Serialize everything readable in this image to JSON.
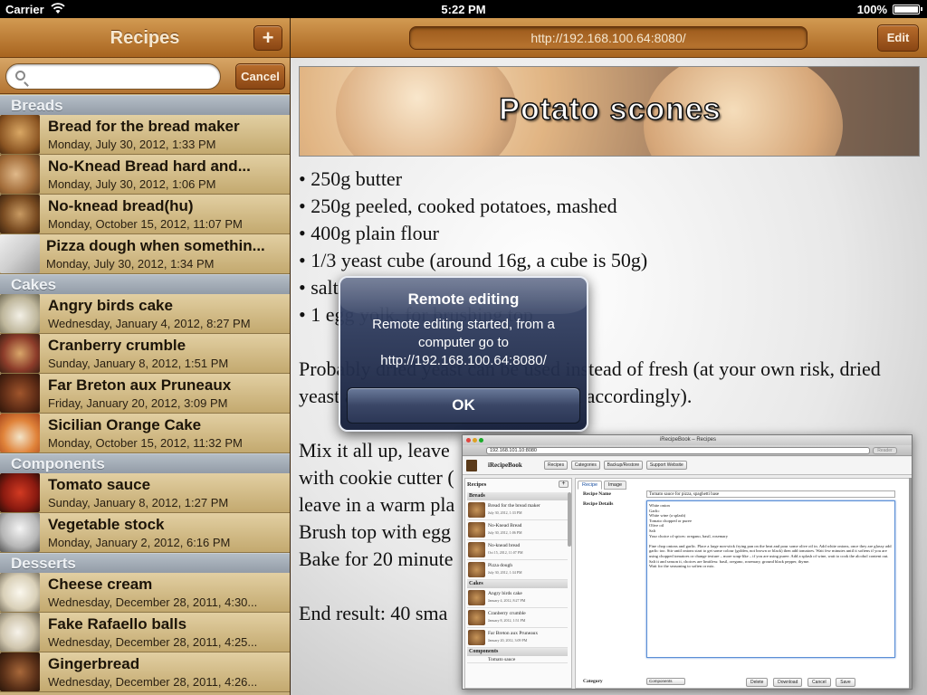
{
  "status_bar": {
    "carrier": "Carrier",
    "time": "5:22 PM",
    "battery": "100%"
  },
  "left_toolbar": {
    "title": "Recipes",
    "add_label": "+"
  },
  "search": {
    "placeholder": "",
    "cancel_label": "Cancel"
  },
  "sections": [
    {
      "name": "Breads",
      "items": [
        {
          "title": "Bread for the bread maker",
          "date": "Monday, July 30, 2012, 1:33 PM"
        },
        {
          "title": "No-Knead Bread hard and...",
          "date": "Monday, July 30, 2012, 1:06 PM"
        },
        {
          "title": "No-knead bread(hu)",
          "date": "Monday, October 15, 2012, 11:07 PM"
        },
        {
          "title": "Pizza dough when somethin...",
          "date": "Monday, July 30, 2012, 1:34 PM"
        }
      ]
    },
    {
      "name": "Cakes",
      "items": [
        {
          "title": "Angry birds cake",
          "date": "Wednesday, January 4, 2012, 8:27 PM"
        },
        {
          "title": "Cranberry crumble",
          "date": "Sunday, January 8, 2012, 1:51 PM"
        },
        {
          "title": "Far Breton aux Pruneaux",
          "date": "Friday, January 20, 2012, 3:09 PM"
        },
        {
          "title": "Sicilian Orange Cake",
          "date": "Monday, October 15, 2012, 11:32 PM"
        }
      ]
    },
    {
      "name": "Components",
      "items": [
        {
          "title": "Tomato sauce",
          "date": "Sunday, January 8, 2012, 1:27 PM"
        },
        {
          "title": "Vegetable stock",
          "date": "Monday, January 2, 2012, 6:16 PM"
        }
      ]
    },
    {
      "name": "Desserts",
      "items": [
        {
          "title": "Cheese cream",
          "date": "Wednesday, December 28, 2011, 4:30..."
        },
        {
          "title": "Fake Rafaello balls",
          "date": "Wednesday, December 28, 2011, 4:25..."
        },
        {
          "title": "Gingerbread",
          "date": "Wednesday, December 28, 2011, 4:26..."
        }
      ]
    }
  ],
  "right_toolbar": {
    "url": "http://192.168.100.64:8080/",
    "edit_label": "Edit"
  },
  "recipe": {
    "title": "Potato scones",
    "ingredients": [
      "• 250g butter",
      "• 250g peeled, cooked potatoes, mashed",
      "• 400g plain flour",
      "• 1/3 yeast cube (around 16g, a cube is 50g)",
      "• salt",
      "• 1 egg yolk, for brushing top"
    ],
    "note": "Probably dried yeast can be used instead of fresh (at your own risk, dried yeast amount has to be recalculated accordingly).",
    "steps": [
      "Mix it all up, leave",
      "with cookie cutter (",
      "leave in a warm pla",
      "Brush top with egg",
      "Bake for 20 minute"
    ],
    "result": "End result: 40 sma"
  },
  "alert": {
    "title": "Remote editing",
    "message": "Remote editing started, from a computer go to http://192.168.100.64:8080/",
    "ok_label": "OK"
  },
  "inset": {
    "window_title": "iRecipeBook – Recipes",
    "address": "192.168.101.10:8080",
    "reader_label": "Reader",
    "app_name": "iRecipeBook",
    "tabs": [
      "Recipes",
      "Categories",
      "Backup/Restore",
      "Support Website"
    ],
    "sidebar_title": "Recipes",
    "sidebar_add": "+",
    "sidebar_sections": [
      {
        "name": "Breads",
        "items": [
          {
            "title": "Bread for the bread maker",
            "date": "July 30, 2012, 1:33 PM"
          },
          {
            "title": "No-Knead Bread",
            "date": "July 30, 2012, 1:06 PM"
          },
          {
            "title": "No-knead bread",
            "date": "Oct 15, 2012, 11:07 PM"
          },
          {
            "title": "Pizza dough",
            "date": "July 30, 2012, 1:34 PM"
          }
        ]
      },
      {
        "name": "Cakes",
        "items": [
          {
            "title": "Angry birds cake",
            "date": "January 4, 2012, 8:27 PM"
          },
          {
            "title": "Cranberry crumble",
            "date": "January 8, 2012, 1:51 PM"
          },
          {
            "title": "Far Breton aux Pruneaux",
            "date": "January 20, 2012, 3:09 PM"
          }
        ]
      },
      {
        "name": "Components",
        "items": [
          {
            "title": "Tomato sauce",
            "date": ""
          }
        ]
      }
    ],
    "main_tabs": [
      "Recipe",
      "Image"
    ],
    "recipe_name_label": "Recipe Name",
    "recipe_name_value": "Tomato sauce for pizza, spaghetti base",
    "recipe_details_label": "Recipe Details",
    "recipe_details_lines": [
      "White onion",
      "Garlic",
      "White wine (a splash)",
      "Tomato chopped or puree",
      "Olive oil",
      "Salt",
      "Your choice of spices: oregano, basil, rosemary",
      "",
      "Fine chop onions and garlic. Place a large non-stick frying pan on the heat and pour some olive oil in. Add white onions, once they are glassy add garlic too. Stir until onions start to get some colour (golden, not brown or black) then add tomatoes. Wait few minutes until it softens if you are using chopped tomatoes or change texture – more soup-like – if you are using puree. Add a splash of wine, wait to cook the alcohol content out. Salt it and season it, choices are limitless: basil, oregano, rosemary, ground black pepper, thyme.",
      "Wait for the seasoning to soften or mix."
    ],
    "category_label": "Category",
    "category_value": "Components",
    "actions": [
      "Delete",
      "Download",
      "Cancel",
      "Save"
    ]
  }
}
